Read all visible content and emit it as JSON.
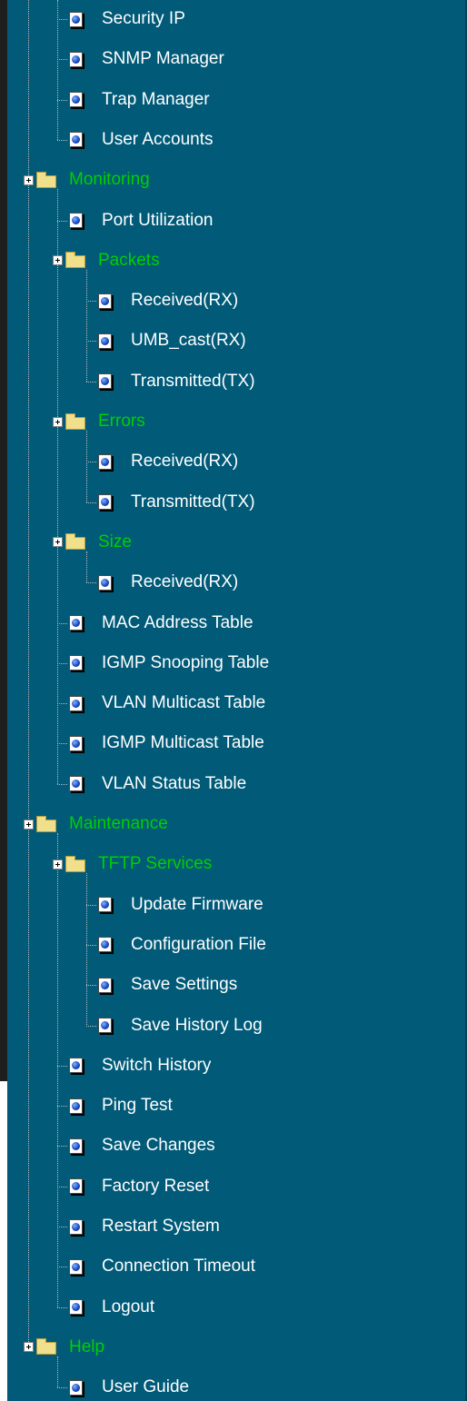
{
  "tree": {
    "items": [
      {
        "label": "Security IP",
        "type": "page",
        "depth": 2
      },
      {
        "label": "SNMP Manager",
        "type": "page",
        "depth": 2
      },
      {
        "label": "Trap Manager",
        "type": "page",
        "depth": 2
      },
      {
        "label": "User Accounts",
        "type": "page",
        "depth": 2
      },
      {
        "label": "Monitoring",
        "type": "folder",
        "depth": 1
      },
      {
        "label": "Port Utilization",
        "type": "page",
        "depth": 2
      },
      {
        "label": "Packets",
        "type": "folder",
        "depth": 2
      },
      {
        "label": "Received(RX)",
        "type": "page",
        "depth": 3
      },
      {
        "label": "UMB_cast(RX)",
        "type": "page",
        "depth": 3
      },
      {
        "label": "Transmitted(TX)",
        "type": "page",
        "depth": 3
      },
      {
        "label": "Errors",
        "type": "folder",
        "depth": 2
      },
      {
        "label": "Received(RX)",
        "type": "page",
        "depth": 3
      },
      {
        "label": "Transmitted(TX)",
        "type": "page",
        "depth": 3
      },
      {
        "label": "Size",
        "type": "folder",
        "depth": 2
      },
      {
        "label": "Received(RX)",
        "type": "page",
        "depth": 3
      },
      {
        "label": "MAC Address Table",
        "type": "page",
        "depth": 2
      },
      {
        "label": "IGMP Snooping Table",
        "type": "page",
        "depth": 2
      },
      {
        "label": "VLAN Multicast Table",
        "type": "page",
        "depth": 2
      },
      {
        "label": "IGMP Multicast Table",
        "type": "page",
        "depth": 2
      },
      {
        "label": "VLAN Status Table",
        "type": "page",
        "depth": 2
      },
      {
        "label": "Maintenance",
        "type": "folder",
        "depth": 1
      },
      {
        "label": "TFTP Services",
        "type": "folder",
        "depth": 2
      },
      {
        "label": "Update Firmware",
        "type": "page",
        "depth": 3
      },
      {
        "label": "Configuration File",
        "type": "page",
        "depth": 3
      },
      {
        "label": "Save Settings",
        "type": "page",
        "depth": 3
      },
      {
        "label": "Save History Log",
        "type": "page",
        "depth": 3
      },
      {
        "label": "Switch History",
        "type": "page",
        "depth": 2
      },
      {
        "label": "Ping Test",
        "type": "page",
        "depth": 2
      },
      {
        "label": "Save Changes",
        "type": "page",
        "depth": 2
      },
      {
        "label": "Factory Reset",
        "type": "page",
        "depth": 2
      },
      {
        "label": "Restart System",
        "type": "page",
        "depth": 2
      },
      {
        "label": "Connection Timeout",
        "type": "page",
        "depth": 2
      },
      {
        "label": "Logout",
        "type": "page",
        "depth": 2
      },
      {
        "label": "Help",
        "type": "folder",
        "depth": 1
      },
      {
        "label": "User Guide",
        "type": "page",
        "depth": 2
      }
    ]
  },
  "colors": {
    "background": "#005a78",
    "page_label": "#ffffff",
    "folder_label": "#00d000"
  }
}
